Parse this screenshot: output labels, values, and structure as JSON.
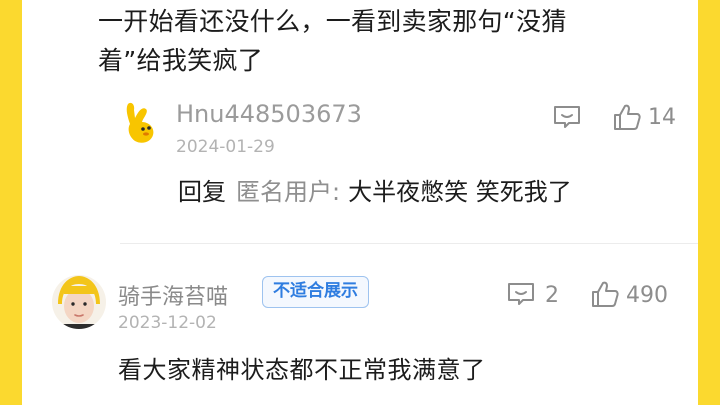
{
  "top_comment": {
    "line1": "一开始看还没什么，一看到卖家那句“没猜",
    "line2": "着”给我笑疯了"
  },
  "reply": {
    "username": "Hnu448503673",
    "date": "2024-01-29",
    "like_count": "14",
    "prefix": "回复",
    "target": "匿名用户",
    "colon": ":",
    "message": "大半夜憋笑 笑死我了"
  },
  "comment": {
    "username": "骑手海苔喵",
    "badge": "不适合展示",
    "date": "2023-12-02",
    "reply_count": "2",
    "like_count": "490",
    "text": "看大家精神状态都不正常我满意了"
  },
  "colors": {
    "background": "#fbd92f",
    "badge_text": "#2f7de0",
    "badge_border": "#9ec3ef"
  },
  "icons": [
    "comment-icon",
    "thumbs-up-icon",
    "user-avatar"
  ]
}
